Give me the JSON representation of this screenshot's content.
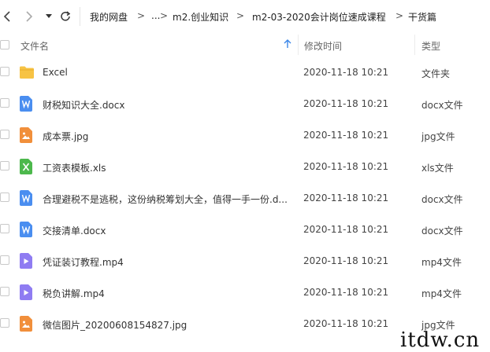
{
  "breadcrumb": {
    "items": [
      "我的网盘",
      "...",
      "m2.创业知识",
      "m2-03-2020会计岗位速成课程",
      "干货篇"
    ],
    "separator": ">"
  },
  "columns": {
    "name": "文件名",
    "modified": "修改时间",
    "type": "类型"
  },
  "files": [
    {
      "name": "Excel",
      "modified": "2020-11-18 10:21",
      "type": "文件夹",
      "icon": "folder-icon"
    },
    {
      "name": "财税知识大全.docx",
      "modified": "2020-11-18 10:21",
      "type": "docx文件",
      "icon": "word-icon"
    },
    {
      "name": "成本票.jpg",
      "modified": "2020-11-18 10:21",
      "type": "jpg文件",
      "icon": "image-icon"
    },
    {
      "name": "工资表模板.xls",
      "modified": "2020-11-18 10:21",
      "type": "xls文件",
      "icon": "excel-icon"
    },
    {
      "name": "合理避税不是逃税，这份纳税筹划大全，值得一手一份.d...",
      "modified": "2020-11-18 10:21",
      "type": "docx文件",
      "icon": "word-icon"
    },
    {
      "name": "交接清单.docx",
      "modified": "2020-11-18 10:21",
      "type": "docx文件",
      "icon": "word-icon"
    },
    {
      "name": "凭证装订教程.mp4",
      "modified": "2020-11-18 10:21",
      "type": "mp4文件",
      "icon": "video-icon"
    },
    {
      "name": "税负讲解.mp4",
      "modified": "2020-11-18 10:21",
      "type": "mp4文件",
      "icon": "video-icon"
    },
    {
      "name": "微信图片_20200608154827.jpg",
      "modified": "2020-11-18 10:21",
      "type": "jpg文件",
      "icon": "image-icon"
    }
  ],
  "watermark": "itdw.cn",
  "colors": {
    "folder": "#f7c344",
    "word": "#4a8ef0",
    "image": "#f18f3b",
    "excel": "#4cb84c",
    "video": "#8f7cf2",
    "sort_arrow": "#3a86e8"
  }
}
